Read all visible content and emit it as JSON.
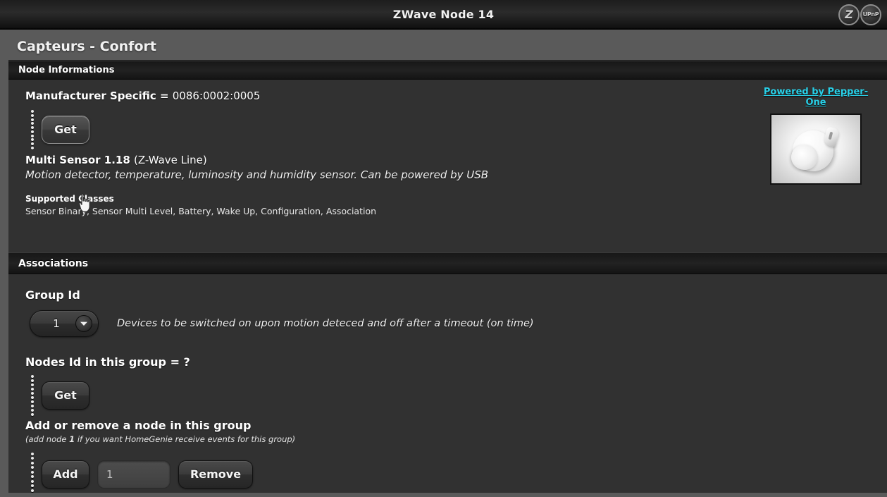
{
  "titlebar": {
    "title": "ZWave Node 14",
    "badges": [
      {
        "name": "zwave-badge",
        "label": "Z"
      },
      {
        "name": "upnp-badge",
        "label": "UPnP"
      }
    ]
  },
  "page": {
    "title": "Capteurs - Confort"
  },
  "node_informations": {
    "section_title": "Node Informations",
    "manufacturer_specific_label": "Manufacturer Specific = ",
    "manufacturer_specific_value": "0086:0002:0005",
    "get_button": "Get",
    "device_name": "Multi Sensor 1.18",
    "device_line": "(Z-Wave Line)",
    "device_description": "Motion detector, temperature, luminosity and humidity sensor. Can be powered by USB",
    "supported_classes_label": "Supported Classes",
    "supported_classes_value": "Sensor Binary, Sensor Multi Level, Battery, Wake Up, Configuration, Association",
    "pepper_link": "Powered by Pepper-One",
    "pepper_link_color": "#29d0e8",
    "product_image_alt": "white motion sensor"
  },
  "associations": {
    "section_title": "Associations",
    "group_id_label": "Group Id",
    "group_id_value": "1",
    "group_id_options": [
      "1"
    ],
    "group_id_description": "Devices to be switched on upon motion deteced and off after a timeout (on time)",
    "nodes_id_label": "Nodes Id in this group = ?",
    "nodes_get_button": "Get",
    "add_remove_label": "Add or remove a node in this group",
    "add_remove_hint_pre": "(add node ",
    "add_remove_hint_bold": "1",
    "add_remove_hint_post": " if you want HomeGenie receive events for this group)",
    "add_button": "Add",
    "node_input_value": "1",
    "node_input_placeholder": "1",
    "remove_button": "Remove"
  }
}
